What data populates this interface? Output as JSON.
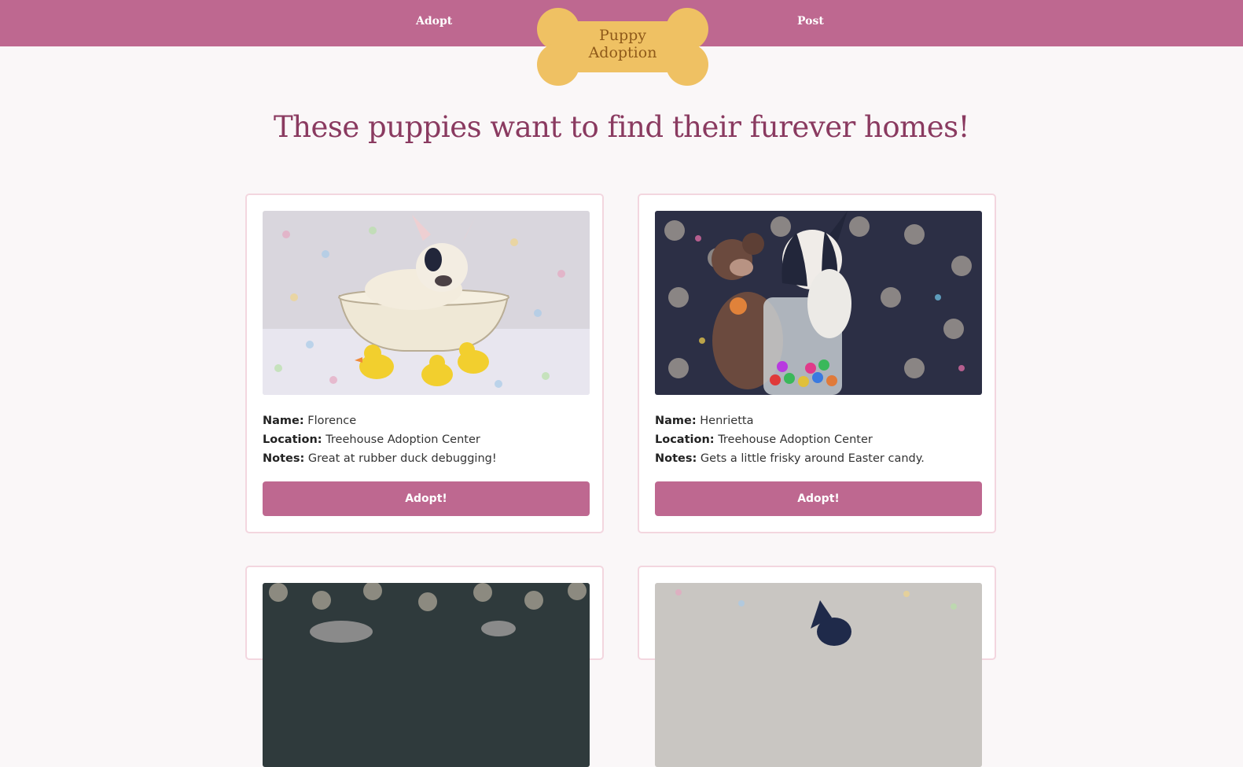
{
  "nav": {
    "adopt_label": "Adopt",
    "post_label": "Post"
  },
  "logo": {
    "line1": "Puppy",
    "line2": "Adoption",
    "icon": "bone-icon"
  },
  "headline": "These puppies want to find their furever homes!",
  "colors": {
    "brand": "#be6890",
    "logo_bone": "#efc163",
    "logo_text": "#8f5a1a",
    "headline": "#8a3a60",
    "card_border": "#f3d6df"
  },
  "cards": [
    {
      "image": "puppy-in-tub-with-rubber-ducks",
      "name_label": "Name:",
      "name": "Florence",
      "location_label": "Location:",
      "location": "Treehouse Adoption Center",
      "notes_label": "Notes:",
      "notes": "Great at rubber duck debugging!",
      "button": "Adopt!"
    },
    {
      "image": "puppy-with-teddy-bear-and-candy-jar",
      "name_label": "Name:",
      "name": "Henrietta",
      "location_label": "Location:",
      "location": "Treehouse Adoption Center",
      "notes_label": "Notes:",
      "notes": "Gets a little frisky around Easter candy.",
      "button": "Adopt!"
    },
    {
      "image": "puppy-on-sugar-skull-fabric"
    },
    {
      "image": "puppy-on-polka-dot-fabric"
    }
  ]
}
